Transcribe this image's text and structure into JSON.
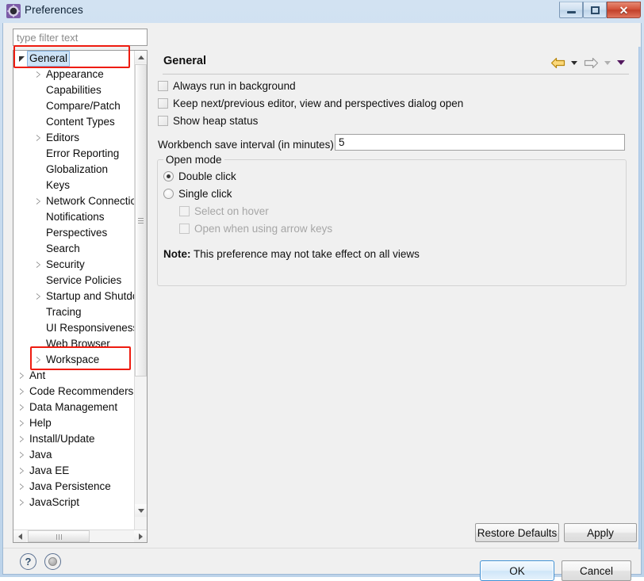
{
  "window": {
    "title": "Preferences",
    "icon": "preferences-gear-icon",
    "controls": {
      "minimize": "minimize-button",
      "maximize": "maximize-button",
      "close": "close-button",
      "close_glyph": "✕"
    }
  },
  "filter": {
    "placeholder": "type filter text",
    "value": ""
  },
  "tree": {
    "items": [
      {
        "label": "General",
        "indent": 0,
        "arrow": "open",
        "selected": true,
        "highlighted": true
      },
      {
        "label": "Appearance",
        "indent": 1,
        "arrow": "closed",
        "selected": false,
        "highlighted": false
      },
      {
        "label": "Capabilities",
        "indent": 1,
        "arrow": "none",
        "selected": false,
        "highlighted": false
      },
      {
        "label": "Compare/Patch",
        "indent": 1,
        "arrow": "none",
        "selected": false,
        "highlighted": false
      },
      {
        "label": "Content Types",
        "indent": 1,
        "arrow": "none",
        "selected": false,
        "highlighted": false
      },
      {
        "label": "Editors",
        "indent": 1,
        "arrow": "closed",
        "selected": false,
        "highlighted": false
      },
      {
        "label": "Error Reporting",
        "indent": 1,
        "arrow": "none",
        "selected": false,
        "highlighted": false
      },
      {
        "label": "Globalization",
        "indent": 1,
        "arrow": "none",
        "selected": false,
        "highlighted": false
      },
      {
        "label": "Keys",
        "indent": 1,
        "arrow": "none",
        "selected": false,
        "highlighted": false
      },
      {
        "label": "Network Connections",
        "indent": 1,
        "arrow": "closed",
        "selected": false,
        "highlighted": false
      },
      {
        "label": "Notifications",
        "indent": 1,
        "arrow": "none",
        "selected": false,
        "highlighted": false
      },
      {
        "label": "Perspectives",
        "indent": 1,
        "arrow": "none",
        "selected": false,
        "highlighted": false
      },
      {
        "label": "Search",
        "indent": 1,
        "arrow": "none",
        "selected": false,
        "highlighted": false
      },
      {
        "label": "Security",
        "indent": 1,
        "arrow": "closed",
        "selected": false,
        "highlighted": false
      },
      {
        "label": "Service Policies",
        "indent": 1,
        "arrow": "none",
        "selected": false,
        "highlighted": false
      },
      {
        "label": "Startup and Shutdown",
        "indent": 1,
        "arrow": "closed",
        "selected": false,
        "highlighted": false
      },
      {
        "label": "Tracing",
        "indent": 1,
        "arrow": "none",
        "selected": false,
        "highlighted": false
      },
      {
        "label": "UI Responsiveness Monitoring",
        "indent": 1,
        "arrow": "none",
        "selected": false,
        "highlighted": false
      },
      {
        "label": "Web Browser",
        "indent": 1,
        "arrow": "none",
        "selected": false,
        "highlighted": false
      },
      {
        "label": "Workspace",
        "indent": 1,
        "arrow": "closed",
        "selected": false,
        "highlighted": true
      },
      {
        "label": "Ant",
        "indent": 0,
        "arrow": "closed",
        "selected": false,
        "highlighted": false
      },
      {
        "label": "Code Recommenders",
        "indent": 0,
        "arrow": "closed",
        "selected": false,
        "highlighted": false
      },
      {
        "label": "Data Management",
        "indent": 0,
        "arrow": "closed",
        "selected": false,
        "highlighted": false
      },
      {
        "label": "Help",
        "indent": 0,
        "arrow": "closed",
        "selected": false,
        "highlighted": false
      },
      {
        "label": "Install/Update",
        "indent": 0,
        "arrow": "closed",
        "selected": false,
        "highlighted": false
      },
      {
        "label": "Java",
        "indent": 0,
        "arrow": "closed",
        "selected": false,
        "highlighted": false
      },
      {
        "label": "Java EE",
        "indent": 0,
        "arrow": "closed",
        "selected": false,
        "highlighted": false
      },
      {
        "label": "Java Persistence",
        "indent": 0,
        "arrow": "closed",
        "selected": false,
        "highlighted": false
      },
      {
        "label": "JavaScript",
        "indent": 0,
        "arrow": "closed",
        "selected": false,
        "highlighted": false
      }
    ]
  },
  "page": {
    "title": "General",
    "nav": {
      "back": "back-arrow-icon",
      "back_menu": "back-dropdown-icon",
      "forward": "forward-arrow-icon",
      "forward_menu": "forward-dropdown-icon",
      "view_menu": "view-menu-icon"
    },
    "checkboxes": [
      {
        "label": "Always run in background",
        "checked": false,
        "enabled": true
      },
      {
        "label": "Keep next/previous editor, view and perspectives dialog open",
        "checked": false,
        "enabled": true
      },
      {
        "label": "Show heap status",
        "checked": false,
        "enabled": true
      }
    ],
    "save_interval": {
      "label": "Workbench save interval (in minutes):",
      "value": "5"
    },
    "open_mode": {
      "legend": "Open mode",
      "radios": [
        {
          "label": "Double click",
          "selected": true
        },
        {
          "label": "Single click",
          "selected": false
        }
      ],
      "sub_checkboxes": [
        {
          "label": "Select on hover",
          "checked": false,
          "enabled": false
        },
        {
          "label": "Open when using arrow keys",
          "checked": false,
          "enabled": false
        }
      ],
      "note_prefix": "Note:",
      "note_text": "This preference may not take effect on all views"
    },
    "buttons": {
      "restore_defaults": "Restore Defaults",
      "apply": "Apply"
    }
  },
  "footer": {
    "help_icon": "?",
    "help_icon_name": "help-icon",
    "prefs_icon_name": "preferences-toggle-icon",
    "ok": "OK",
    "cancel": "Cancel"
  },
  "colors": {
    "accent": "#3c8fd4",
    "annotation": "#ee1c10",
    "selection": "#cde3f7",
    "dialog_bg": "#f0f0f0"
  }
}
